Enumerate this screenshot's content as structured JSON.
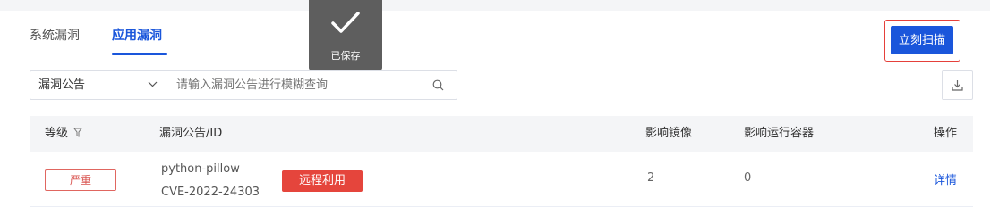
{
  "tabs": [
    {
      "label": "系统漏洞",
      "active": false
    },
    {
      "label": "应用漏洞",
      "active": true
    }
  ],
  "toast": {
    "message": "已保存",
    "icon": "checkmark-icon"
  },
  "actions": {
    "scan_label": "立刻扫描"
  },
  "filter": {
    "select_value": "漏洞公告",
    "search_placeholder": "请输入漏洞公告进行模糊查询"
  },
  "table": {
    "columns": {
      "level": "等级",
      "bulletin": "漏洞公告/ID",
      "images": "影响镜像",
      "containers": "影响运行容器",
      "ops": "操作"
    },
    "rows": [
      {
        "severity": "严重",
        "package": "python-pillow",
        "cve": "CVE-2022-24303",
        "tag": "远程利用",
        "images": "2",
        "containers": "0",
        "action": "详情"
      }
    ]
  },
  "colors": {
    "accent": "#1a56db",
    "danger": "#e5453c",
    "highlight_border": "#e5403a"
  }
}
